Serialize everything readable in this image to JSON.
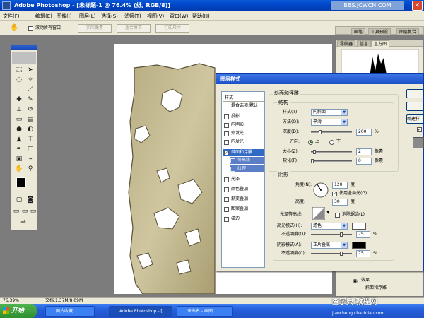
{
  "window": {
    "title": "Adobe Photoshop - [未标题-1 @ 76.4% (纸, RGB/8)]",
    "watermark": "BBS.JCWCN.COM",
    "close_glyph": "✕"
  },
  "menu": [
    "文件(F)",
    "编辑(E)",
    "图像(I)",
    "图层(L)",
    "选择(S)",
    "滤镜(T)",
    "视图(V)",
    "窗口(W)",
    "帮助(H)"
  ],
  "options_bar": {
    "scroll_all": "滚动所有窗口",
    "btn1": "实际像素",
    "btn2": "适合屏幕",
    "btn3": "打印尺寸"
  },
  "dialog": {
    "title": "图层样式",
    "list_header": "样式",
    "blend_options": "混合选项:默认",
    "styles": [
      {
        "label": "投影",
        "checked": false
      },
      {
        "label": "内阴影",
        "checked": false
      },
      {
        "label": "外发光",
        "checked": false
      },
      {
        "label": "内发光",
        "checked": false
      },
      {
        "label": "斜面和浮雕",
        "checked": true,
        "selected": true
      },
      {
        "label": "等高线",
        "checked": false,
        "sub": true
      },
      {
        "label": "纹理",
        "checked": false,
        "sub": true
      },
      {
        "label": "光泽",
        "checked": false
      },
      {
        "label": "颜色叠加",
        "checked": false
      },
      {
        "label": "渐变叠加",
        "checked": false
      },
      {
        "label": "图案叠加",
        "checked": false
      },
      {
        "label": "描边",
        "checked": false
      }
    ],
    "section_title": "斜面和浮雕",
    "structure": {
      "label": "结构",
      "style_label": "样式(T):",
      "style_value": "内斜面",
      "method_label": "方法(Q):",
      "method_value": "平滑",
      "depth_label": "深度(D):",
      "depth_value": "200",
      "depth_unit": "%",
      "direction_label": "方向:",
      "dir_up": "上",
      "dir_down": "下",
      "size_label": "大小(Z):",
      "size_value": "2",
      "size_unit": "像素",
      "soften_label": "软化(F):",
      "soften_value": "0",
      "soften_unit": "像素",
      "depth_fraction": 0.2,
      "size_fraction": 0.05,
      "soften_fraction": 0.0
    },
    "shading": {
      "label": "阴影",
      "angle_label": "角度(N):",
      "angle_value": "120",
      "angle_unit": "度",
      "global_light": "使用全局光(G)",
      "global_light_checked": true,
      "altitude_label": "高度:",
      "altitude_value": "30",
      "altitude_unit": "度",
      "contour_label": "光泽等高线:",
      "antialias": "消除锯齿(L)",
      "antialias_checked": false,
      "highlight_mode_label": "高光模式(H):",
      "highlight_mode_value": "滤色",
      "highlight_opacity_label": "不透明度(O):",
      "highlight_opacity_value": "75",
      "opacity_unit": "%",
      "shadow_mode_label": "阴影模式(A):",
      "shadow_mode_value": "正片叠底",
      "shadow_opacity_label": "不透明度(C):",
      "shadow_opacity_value": "75",
      "highlight_color": "#ffffff",
      "shadow_color": "#000000",
      "highlight_opacity_fraction": 0.75,
      "shadow_opacity_fraction": 0.75
    },
    "buttons": [
      "",
      "",
      "",
      "新建样"
    ]
  },
  "navigator": {
    "tabs": [
      "导航器",
      "信息",
      "直方图"
    ]
  },
  "top_panel_tabs": [
    "画笔",
    "工具预设",
    "图层复合"
  ],
  "layers": {
    "effects": "效果",
    "bevel": "斜面和浮雕"
  },
  "status": {
    "zoom": "76.39%",
    "doc": "文档:1.37M/8.09M"
  },
  "taskbar": {
    "start": "开始",
    "tasks": [
      "图片收藏",
      "Adobe Photoshop - [...",
      "未命名 - 画图"
    ],
    "watermark": "查字典 教程网",
    "watermark_url": "jiaocheng.chazidian.com"
  }
}
